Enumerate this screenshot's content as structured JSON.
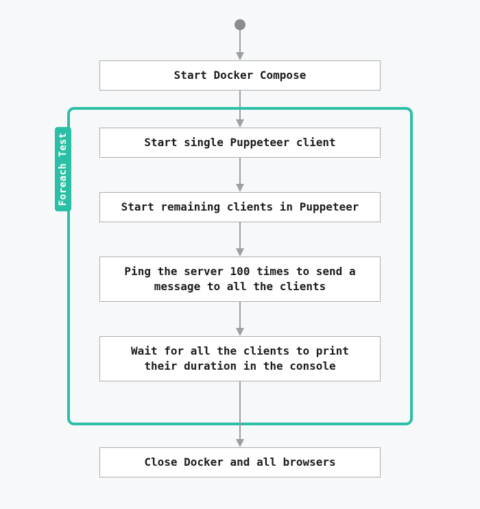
{
  "loop_label": "Foreach Test",
  "nodes": {
    "n1": "Start Docker Compose",
    "n2": "Start single Puppeteer client",
    "n3": "Start remaining clients in Puppeteer",
    "n4": "Ping the server 100 times to send a message to all the clients",
    "n5": "Wait for all the clients to print their duration in the console",
    "n6": "Close Docker and all browsers"
  }
}
